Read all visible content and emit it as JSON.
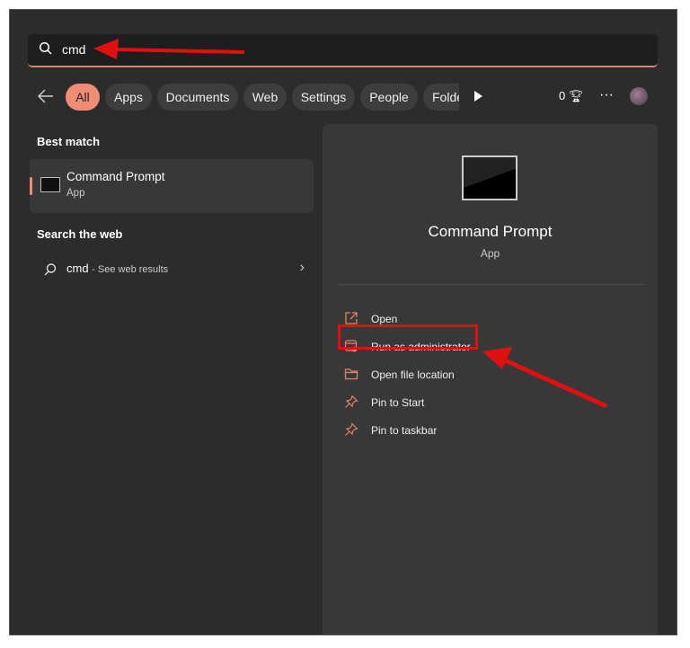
{
  "search": {
    "value": "cmd",
    "icon": "search-icon"
  },
  "filters": {
    "chips": [
      "All",
      "Apps",
      "Documents",
      "Web",
      "Settings",
      "People",
      "Folde"
    ],
    "points": "0"
  },
  "left": {
    "best_match_heading": "Best match",
    "best_match": {
      "title": "Command Prompt",
      "subtitle": "App"
    },
    "web_heading": "Search the web",
    "web_result": {
      "query": "cmd",
      "suffix": "- See web results"
    }
  },
  "detail": {
    "title": "Command Prompt",
    "subtitle": "App",
    "actions": [
      "Open",
      "Run as administrator",
      "Open file location",
      "Pin to Start",
      "Pin to taskbar"
    ]
  },
  "colors": {
    "accent": "#ef8c74",
    "annotation": "#e01010"
  }
}
